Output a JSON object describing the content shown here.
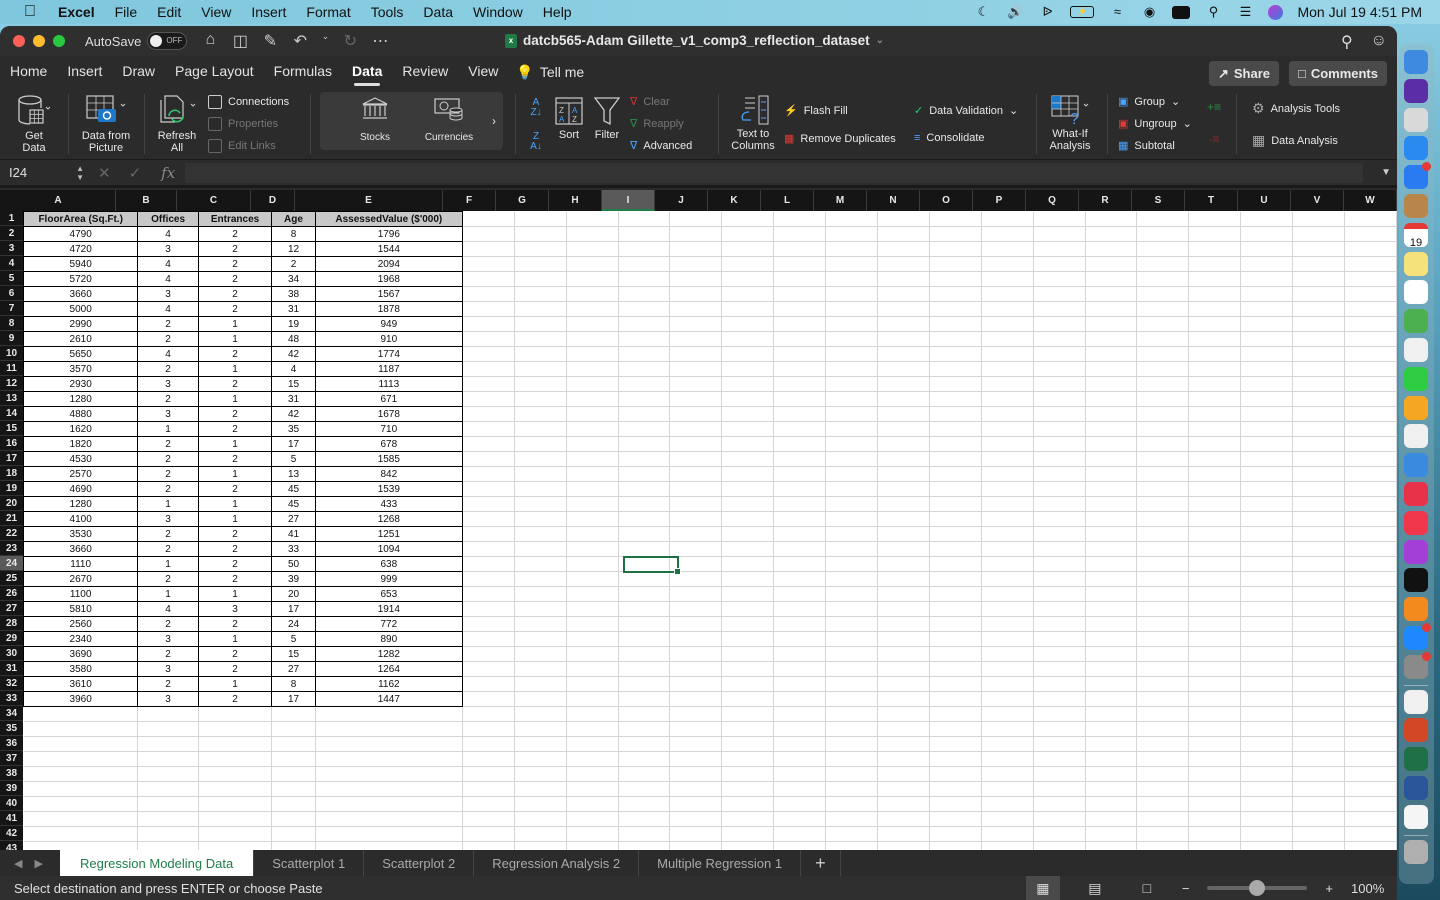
{
  "menubar": {
    "app_name": "Excel",
    "items": [
      "File",
      "Edit",
      "View",
      "Insert",
      "Format",
      "Tools",
      "Data",
      "Window",
      "Help"
    ],
    "clock": "Mon Jul 19  4:51 PM",
    "status_icons": [
      "moon-icon",
      "volume-icon",
      "bluetooth-icon",
      "battery-icon",
      "wifi-icon",
      "user-icon",
      "keyboard-icon",
      "spotlight-icon",
      "control-center-icon",
      "siri-icon"
    ]
  },
  "window": {
    "autosave_label": "AutoSave",
    "autosave_state": "OFF",
    "doc_title": "datcb565-Adam Gillette_v1_comp3_reflection_dataset"
  },
  "ribbon_tabs": [
    "Home",
    "Insert",
    "Draw",
    "Page Layout",
    "Formulas",
    "Data",
    "Review",
    "View"
  ],
  "active_tab": "Data",
  "tell_me": "Tell me",
  "share_label": "Share",
  "comments_label": "Comments",
  "ribbon": {
    "get_data": "Get Data",
    "data_from_picture": "Data from Picture",
    "refresh_all": "Refresh All",
    "connections": "Connections",
    "properties": "Properties",
    "edit_links": "Edit Links",
    "stocks": "Stocks",
    "currencies": "Currencies",
    "sort": "Sort",
    "filter": "Filter",
    "clear": "Clear",
    "reapply": "Reapply",
    "advanced": "Advanced",
    "text_to_columns": "Text to Columns",
    "flash_fill": "Flash Fill",
    "remove_duplicates": "Remove Duplicates",
    "data_validation": "Data Validation",
    "consolidate": "Consolidate",
    "what_if": "What-If Analysis",
    "group": "Group",
    "ungroup": "Ungroup",
    "subtotal": "Subtotal",
    "analysis_tools": "Analysis Tools",
    "data_analysis": "Data Analysis"
  },
  "formula_bar": {
    "name_box": "I24",
    "formula": ""
  },
  "columns": [
    "A",
    "B",
    "C",
    "D",
    "E",
    "F",
    "G",
    "H",
    "I",
    "J",
    "K",
    "L",
    "M",
    "N",
    "O",
    "P",
    "Q",
    "R",
    "S",
    "T",
    "U",
    "V",
    "W"
  ],
  "selected_column": "I",
  "selected_row": 24,
  "row_numbers": [
    1,
    2,
    3,
    4,
    5,
    6,
    7,
    8,
    9,
    10,
    11,
    12,
    13,
    14,
    15,
    16,
    17,
    18,
    19,
    20,
    21,
    22,
    23,
    24,
    25,
    26,
    27,
    28,
    29,
    30,
    31,
    32,
    33,
    34,
    35,
    36,
    37,
    38,
    39,
    40,
    41,
    42,
    43
  ],
  "sheet": {
    "headers": [
      "FloorArea (Sq.Ft.)",
      "Offices",
      "Entrances",
      "Age",
      "AssessedValue ($'000)"
    ],
    "rows": [
      [
        4790,
        4,
        2,
        8,
        1796
      ],
      [
        4720,
        3,
        2,
        12,
        1544
      ],
      [
        5940,
        4,
        2,
        2,
        2094
      ],
      [
        5720,
        4,
        2,
        34,
        1968
      ],
      [
        3660,
        3,
        2,
        38,
        1567
      ],
      [
        5000,
        4,
        2,
        31,
        1878
      ],
      [
        2990,
        2,
        1,
        19,
        949
      ],
      [
        2610,
        2,
        1,
        48,
        910
      ],
      [
        5650,
        4,
        2,
        42,
        1774
      ],
      [
        3570,
        2,
        1,
        4,
        1187
      ],
      [
        2930,
        3,
        2,
        15,
        1113
      ],
      [
        1280,
        2,
        1,
        31,
        671
      ],
      [
        4880,
        3,
        2,
        42,
        1678
      ],
      [
        1620,
        1,
        2,
        35,
        710
      ],
      [
        1820,
        2,
        1,
        17,
        678
      ],
      [
        4530,
        2,
        2,
        5,
        1585
      ],
      [
        2570,
        2,
        1,
        13,
        842
      ],
      [
        4690,
        2,
        2,
        45,
        1539
      ],
      [
        1280,
        1,
        1,
        45,
        433
      ],
      [
        4100,
        3,
        1,
        27,
        1268
      ],
      [
        3530,
        2,
        2,
        41,
        1251
      ],
      [
        3660,
        2,
        2,
        33,
        1094
      ],
      [
        1110,
        1,
        2,
        50,
        638
      ],
      [
        2670,
        2,
        2,
        39,
        999
      ],
      [
        1100,
        1,
        1,
        20,
        653
      ],
      [
        5810,
        4,
        3,
        17,
        1914
      ],
      [
        2560,
        2,
        2,
        24,
        772
      ],
      [
        2340,
        3,
        1,
        5,
        890
      ],
      [
        3690,
        2,
        2,
        15,
        1282
      ],
      [
        3580,
        3,
        2,
        27,
        1264
      ],
      [
        3610,
        2,
        1,
        8,
        1162
      ],
      [
        3960,
        3,
        2,
        17,
        1447
      ]
    ]
  },
  "sheet_tabs": [
    "Regression Modeling Data",
    "Scatterplot 1",
    "Scatterplot 2",
    "Regression Analysis 2",
    "Multiple Regression 1"
  ],
  "active_sheet": "Regression Modeling Data",
  "add_sheet": "+",
  "status": {
    "message": "Select destination and press ENTER or choose Paste",
    "zoom": "100%",
    "zoom_fraction": 0.5
  },
  "dock": {
    "apps": [
      "Finder",
      "Siri",
      "Launchpad",
      "Safari",
      "Mail",
      "Contacts",
      "Calendar",
      "Notes",
      "Reminders",
      "Maps",
      "Photos",
      "FaceTime",
      "Pages",
      "Numbers",
      "Keynote",
      "News",
      "Music",
      "Podcasts",
      "TV",
      "Books",
      "App Store",
      "System Preferences",
      "Creative Cloud",
      "PowerPoint",
      "Excel",
      "Word",
      "Writer",
      "Trash"
    ],
    "calendar_month": "JUL",
    "calendar_day": "19"
  },
  "colors": {
    "accent_green": "#1e7d4a",
    "header_bg": "#151515",
    "ribbon_bg": "#2b2b2b"
  }
}
